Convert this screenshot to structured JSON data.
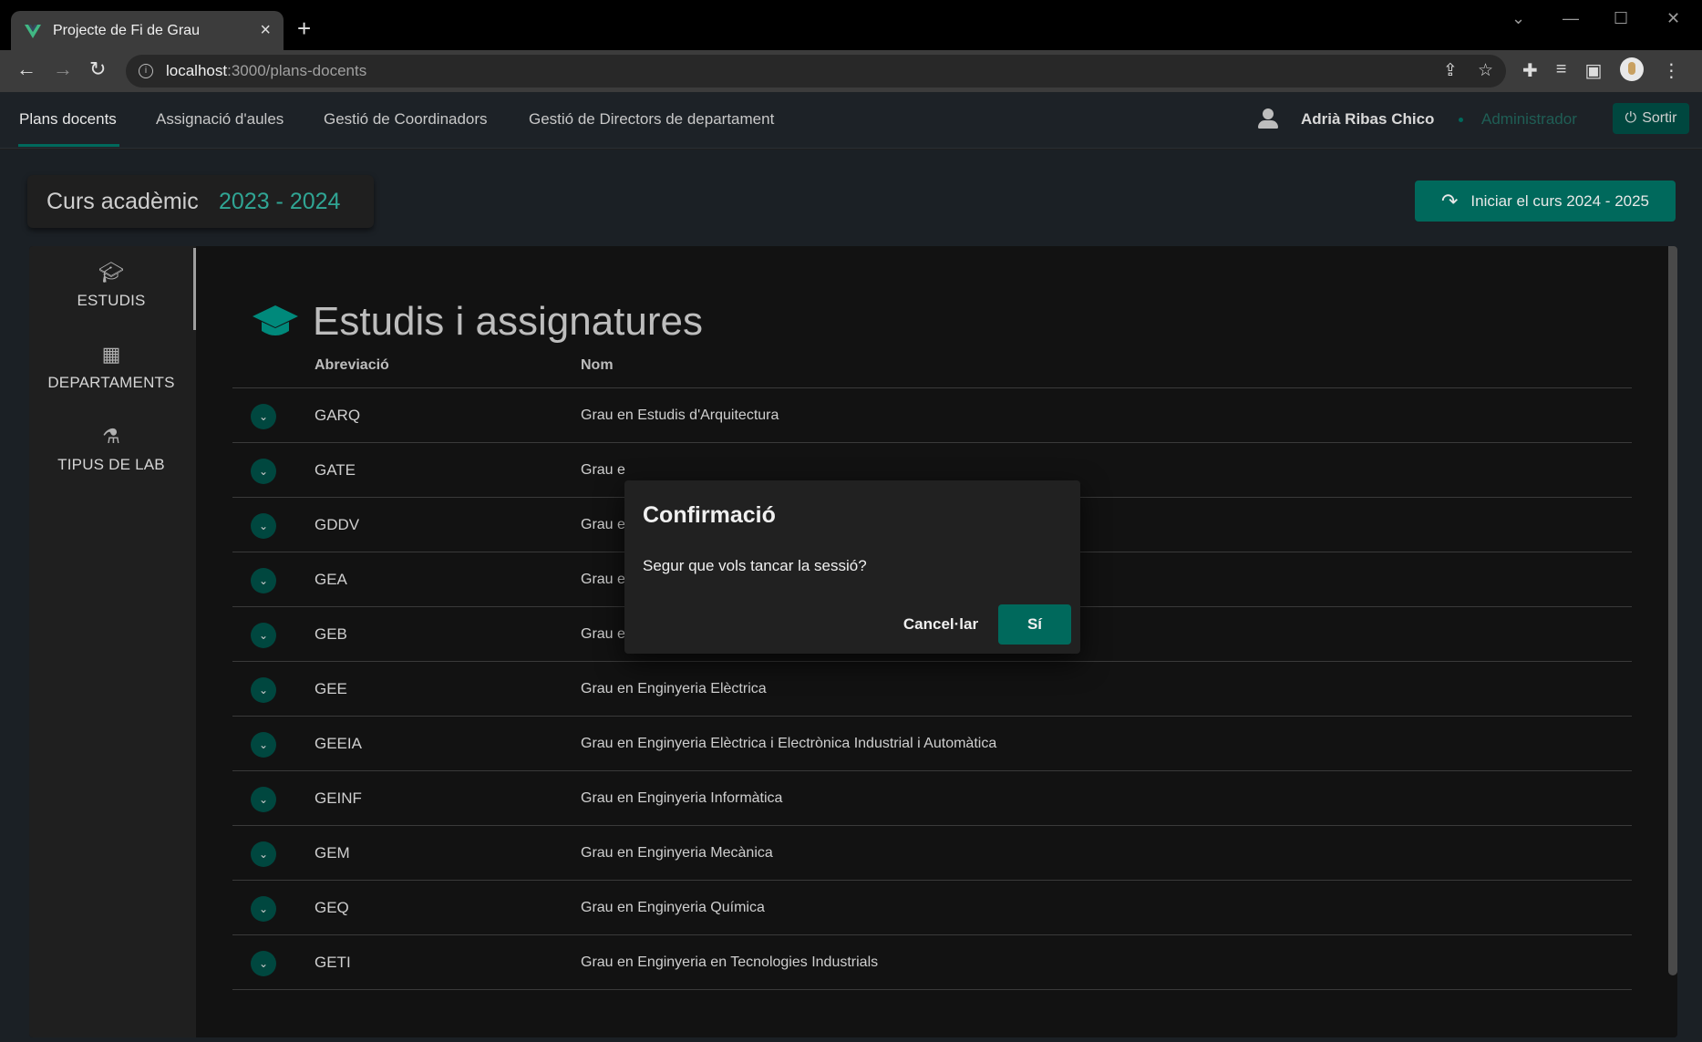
{
  "browser": {
    "tab_title": "Projecte de Fi de Grau",
    "url_host": "localhost",
    "url_path": ":3000/plans-docents"
  },
  "nav": {
    "items": [
      {
        "label": "Plans docents"
      },
      {
        "label": "Assignació d'aules"
      },
      {
        "label": "Gestió de Coordinadors"
      },
      {
        "label": "Gestió de Directors de departament"
      }
    ],
    "user_name": "Adrià Ribas Chico",
    "role": "Administrador",
    "logout_label": "Sortir"
  },
  "course": {
    "label": "Curs acadèmic",
    "value": "2023 - 2024",
    "start_button": "Iniciar el curs 2024 - 2025"
  },
  "sidebar": {
    "items": [
      {
        "label": "ESTUDIS",
        "icon": "graduation-cap-icon"
      },
      {
        "label": "DEPARTAMENTS",
        "icon": "building-icon"
      },
      {
        "label": "TIPUS DE LAB",
        "icon": "flask-icon"
      }
    ]
  },
  "main": {
    "title": "Estudis i assignatures",
    "columns": {
      "abbr": "Abreviació",
      "name": "Nom"
    },
    "rows": [
      {
        "abbr": "GARQ",
        "name": "Grau en Estudis d'Arquitectura"
      },
      {
        "abbr": "GATE",
        "name": "Grau e"
      },
      {
        "abbr": "GDDV",
        "name": "Grau e"
      },
      {
        "abbr": "GEA",
        "name": "Grau e"
      },
      {
        "abbr": "GEB",
        "name": "Grau en Enginyeria Biomèdica"
      },
      {
        "abbr": "GEE",
        "name": "Grau en Enginyeria Elèctrica"
      },
      {
        "abbr": "GEEIA",
        "name": "Grau en Enginyeria Elèctrica i Electrònica Industrial i Automàtica"
      },
      {
        "abbr": "GEINF",
        "name": "Grau en Enginyeria Informàtica"
      },
      {
        "abbr": "GEM",
        "name": "Grau en Enginyeria Mecànica"
      },
      {
        "abbr": "GEQ",
        "name": "Grau en Enginyeria Química"
      },
      {
        "abbr": "GETI",
        "name": "Grau en Enginyeria en Tecnologies Industrials"
      }
    ]
  },
  "dialog": {
    "title": "Confirmació",
    "message": "Segur que vols tancar la sessió?",
    "cancel_label": "Cancel·lar",
    "confirm_label": "Sí"
  },
  "colors": {
    "accent": "#00695c",
    "accent_text": "#30a594"
  }
}
